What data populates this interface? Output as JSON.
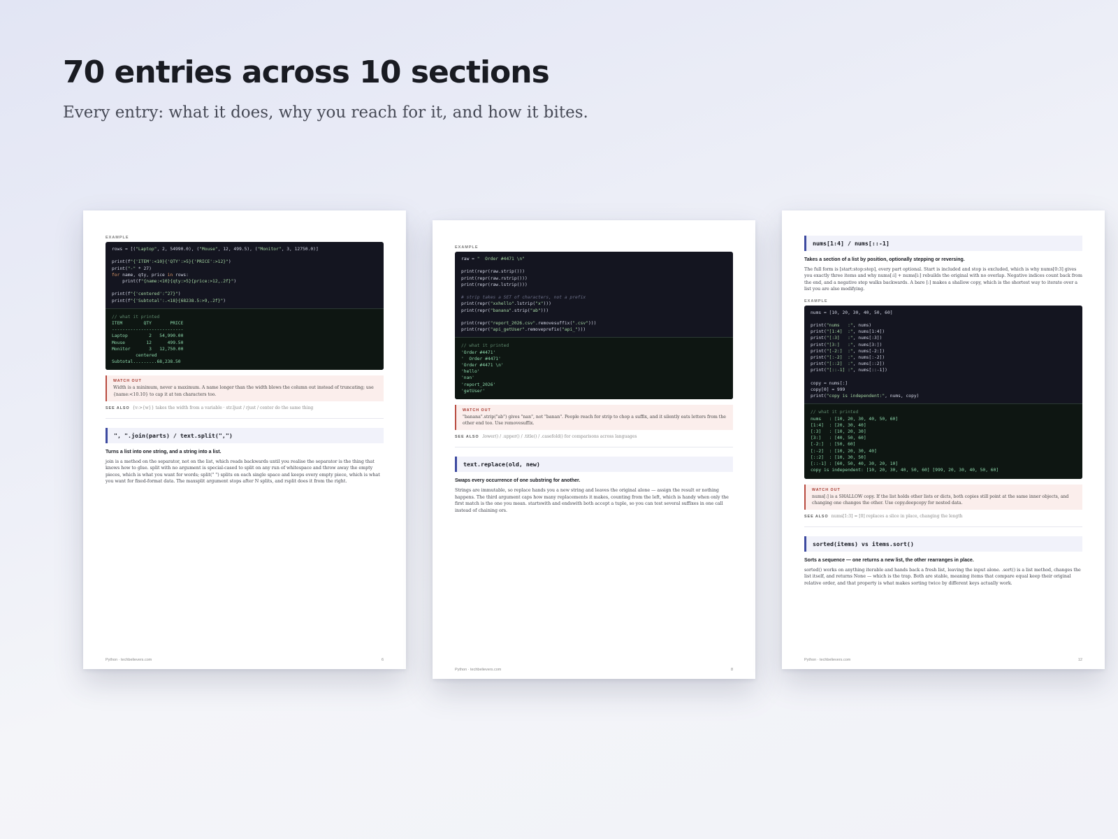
{
  "header": {
    "title": "70 entries across 10 sections",
    "subtitle": "Every entry: what it does, why you reach for it, and how it bites."
  },
  "labels": {
    "example": "EXAMPLE",
    "watch_out": "WATCH OUT",
    "see_also": "SEE ALSO",
    "output_comment": "// what it printed"
  },
  "pages": [
    {
      "top": {
        "code_lines": [
          [
            [
              "rows = [(",
              ""
            ],
            [
              "\"Laptop\"",
              "s"
            ],
            [
              ", 2, 54990.0), (",
              ""
            ],
            [
              "\"Mouse\"",
              "s"
            ],
            [
              ", 12, 499.5), (",
              ""
            ],
            [
              "\"Monitor\"",
              "s"
            ],
            [
              ", 3, 12750.0)]",
              ""
            ]
          ],
          [],
          [
            [
              "print(f",
              ""
            ],
            [
              "\"{'ITEM':<10}{'QTY':>5}{'PRICE':>12}\"",
              "s"
            ],
            [
              ")",
              ""
            ]
          ],
          [
            [
              "print(",
              ""
            ],
            [
              "\"-\"",
              "s"
            ],
            [
              " * 27)",
              ""
            ]
          ],
          [
            [
              "for",
              "k"
            ],
            [
              " name, qty, price ",
              ""
            ],
            [
              "in",
              "k"
            ],
            [
              " rows:",
              ""
            ]
          ],
          [
            [
              "    print(f",
              ""
            ],
            [
              "\"{name:<10}{qty:>5}{price:>12,.2f}\"",
              "s"
            ],
            [
              ")",
              ""
            ]
          ],
          [],
          [
            [
              "print(f",
              ""
            ],
            [
              "\"{'centered':^27}\"",
              "s"
            ],
            [
              ")",
              ""
            ]
          ],
          [
            [
              "print(f",
              ""
            ],
            [
              "\"{'Subtotal':.<18}{68238.5:>9,.2f}\"",
              "s"
            ],
            [
              ")",
              ""
            ]
          ]
        ],
        "output": "ITEM        QTY       PRICE\n---------------------------\nLaptop        2   54,990.00\nMouse        12      499.50\nMonitor       3   12,750.00\n         centered\nSubtotal.........68,238.50",
        "watch": "Width is a minimum, never a maximum. A name longer than the width blows the column out instead of truncating; use {name:<10.10} to cap it at ten characters too.",
        "see_also": "{v:>{w}} takes the width from a variable · str.ljust / rjust / center do the same thing"
      },
      "entry": {
        "heading": "\", \".join(parts)  /  text.split(\",\")",
        "summary": "Turns a list into one string, and a string into a list.",
        "body": "join is a method on the separator, not on the list, which reads backwards until you realise the separator is the thing that knows how to glue. split with no argument is special-cased to split on any run of whitespace and throw away the empty pieces, which is what you want for words; split(\" \") splits on each single space and keeps every empty piece, which is what you want for fixed-format data. The maxsplit argument stops after N splits, and rsplit does it from the right."
      },
      "footer_left": "Python · techbelievers.com",
      "footer_right": "6"
    },
    {
      "top": {
        "code_lines": [
          [
            [
              "raw = ",
              ""
            ],
            [
              "\"  Order #4471 \\n\"",
              "s"
            ]
          ],
          [],
          [
            [
              "print(repr(raw.strip()))",
              ""
            ]
          ],
          [
            [
              "print(repr(raw.rstrip()))",
              ""
            ]
          ],
          [
            [
              "print(repr(raw.lstrip()))",
              ""
            ]
          ],
          [],
          [
            [
              "# strip takes a SET of characters, not a prefix",
              "c"
            ]
          ],
          [
            [
              "print(repr(",
              ""
            ],
            [
              "\"xxhello\"",
              "s"
            ],
            [
              ".lstrip(",
              ""
            ],
            [
              "\"x\"",
              "s"
            ],
            [
              ")))",
              ""
            ]
          ],
          [
            [
              "print(repr(",
              ""
            ],
            [
              "\"banana\"",
              "s"
            ],
            [
              ".strip(",
              ""
            ],
            [
              "\"ab\"",
              "s"
            ],
            [
              ")))",
              ""
            ]
          ],
          [],
          [
            [
              "print(repr(",
              ""
            ],
            [
              "\"report_2026.csv\"",
              "s"
            ],
            [
              ".removesuffix(",
              ""
            ],
            [
              "\".csv\"",
              "s"
            ],
            [
              ")))",
              ""
            ]
          ],
          [
            [
              "print(repr(",
              ""
            ],
            [
              "\"api_getUser\"",
              "s"
            ],
            [
              ".removeprefix(",
              ""
            ],
            [
              "\"api_\"",
              "s"
            ],
            [
              ")))",
              ""
            ]
          ]
        ],
        "output": "'Order #4471'\n'  Order #4471'\n'Order #4471 \\n'\n'hello'\n'nan'\n'report_2026'\n'getUser'",
        "watch": "\"banana\".strip(\"ab\") gives \"nan\", not \"banan\". People reach for strip to chop a suffix, and it silently eats letters from the other end too. Use removesuffix.",
        "see_also": ".lower() / .upper() / .title() / .casefold() for comparisons across languages"
      },
      "entry": {
        "heading": "text.replace(old, new)",
        "summary": "Swaps every occurrence of one substring for another.",
        "body": "Strings are immutable, so replace hands you a new string and leaves the original alone — assign the result or nothing happens. The third argument caps how many replacements it makes, counting from the left, which is handy when only the first match is the one you mean. startswith and endswith both accept a tuple, so you can test several suffixes in one call instead of chaining ors."
      },
      "footer_left": "Python · techbelievers.com",
      "footer_right": "8"
    },
    {
      "entry": {
        "heading": "nums[1:4]  /  nums[::-1]",
        "summary": "Takes a section of a list by position, optionally stepping or reversing.",
        "body": "The full form is [start:stop:step], every part optional. Start is included and stop is excluded, which is why nums[0:3] gives you exactly three items and why nums[:i] + nums[i:] rebuilds the original with no overlap. Negative indices count back from the end, and a negative step walks backwards. A bare [:] makes a shallow copy, which is the shortest way to iterate over a list you are also modifying."
      },
      "example": {
        "code_lines": [
          [
            [
              "nums = [10, 20, 30, 40, 50, 60]",
              ""
            ]
          ],
          [],
          [
            [
              "print(",
              ""
            ],
            [
              "\"nums   :\"",
              "s"
            ],
            [
              ", nums)",
              ""
            ]
          ],
          [
            [
              "print(",
              ""
            ],
            [
              "\"[1:4]  :\"",
              "s"
            ],
            [
              ", nums[1:4])",
              ""
            ]
          ],
          [
            [
              "print(",
              ""
            ],
            [
              "\"[:3]   :\"",
              "s"
            ],
            [
              ", nums[:3])",
              ""
            ]
          ],
          [
            [
              "print(",
              ""
            ],
            [
              "\"[3:]   :\"",
              "s"
            ],
            [
              ", nums[3:])",
              ""
            ]
          ],
          [
            [
              "print(",
              ""
            ],
            [
              "\"[-2:]  :\"",
              "s"
            ],
            [
              ", nums[-2:])",
              ""
            ]
          ],
          [
            [
              "print(",
              ""
            ],
            [
              "\"[:-2]  :\"",
              "s"
            ],
            [
              ", nums[:-2])",
              ""
            ]
          ],
          [
            [
              "print(",
              ""
            ],
            [
              "\"[::2]  :\"",
              "s"
            ],
            [
              ", nums[::2])",
              ""
            ]
          ],
          [
            [
              "print(",
              ""
            ],
            [
              "\"[::-1] :\"",
              "s"
            ],
            [
              ", nums[::-1])",
              ""
            ]
          ],
          [],
          [
            [
              "copy = nums[:]",
              ""
            ]
          ],
          [
            [
              "copy[0] = 999",
              ""
            ]
          ],
          [
            [
              "print(",
              ""
            ],
            [
              "\"copy is independent:\"",
              "s"
            ],
            [
              ", nums, copy)",
              ""
            ]
          ]
        ],
        "output": "nums   : [10, 20, 30, 40, 50, 60]\n[1:4]  : [20, 30, 40]\n[:3]   : [10, 20, 30]\n[3:]   : [40, 50, 60]\n[-2:]  : [50, 60]\n[:-2]  : [10, 20, 30, 40]\n[::2]  : [10, 30, 50]\n[::-1] : [60, 50, 40, 30, 20, 10]\ncopy is independent: [10, 20, 30, 40, 50, 60] [999, 20, 30, 40, 50, 60]",
        "watch": "nums[:] is a SHALLOW copy. If the list holds other lists or dicts, both copies still point at the same inner objects, and changing one changes the other. Use copy.deepcopy for nested data.",
        "see_also": "nums[1:3] = [0] replaces a slice in place, changing the length"
      },
      "entry2": {
        "heading": "sorted(items)  vs  items.sort()",
        "summary": "Sorts a sequence — one returns a new list, the other rearranges in place.",
        "body": "sorted() works on anything iterable and hands back a fresh list, leaving the input alone. .sort() is a list method, changes the list itself, and returns None — which is the trap. Both are stable, meaning items that compare equal keep their original relative order, and that property is what makes sorting twice by different keys actually work."
      },
      "footer_left": "Python · techbelievers.com",
      "footer_right": "12"
    }
  ]
}
